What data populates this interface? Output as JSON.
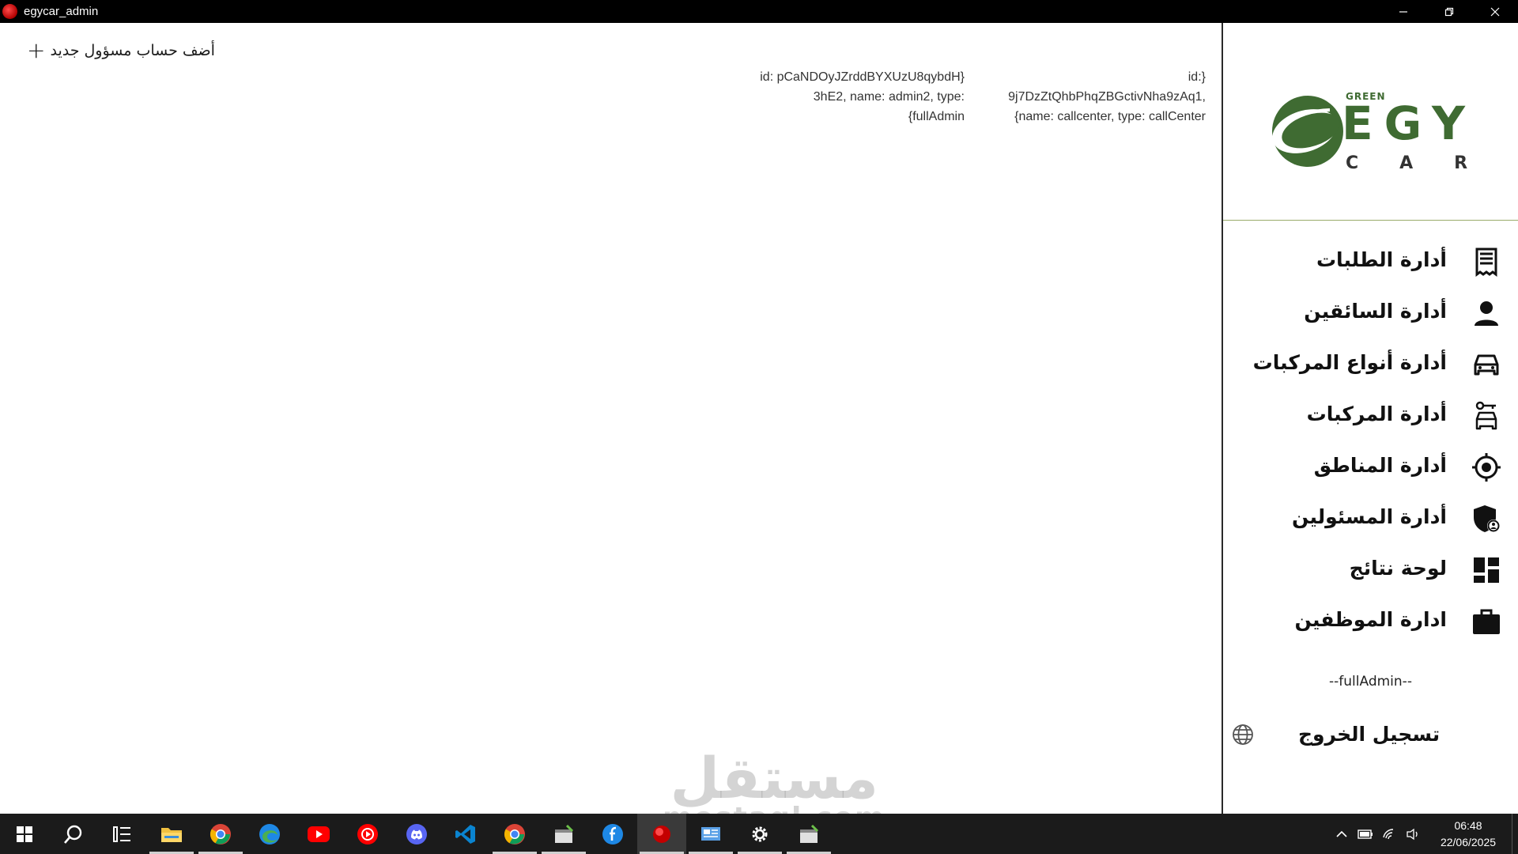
{
  "window": {
    "title": "egycar_admin"
  },
  "main": {
    "add_admin_label": "أضف حساب مسؤول جديد",
    "records": [
      {
        "lines": [
          "id:}",
          "9j7DzZtQhbPhqZBGctivNha9zAq1,",
          "{name: callcenter, type: callCenter"
        ]
      },
      {
        "lines": [
          "id: pCaNDOyJZrddBYXUzU8qybdH}",
          "3hE2, name: admin2, type:",
          "{fullAdmin"
        ]
      }
    ]
  },
  "sidebar": {
    "logo": {
      "small": "GREEN",
      "line1": "EGY",
      "line2": "CAR"
    },
    "items": [
      {
        "label": "أدارة الطلبات",
        "icon": "receipt-icon"
      },
      {
        "label": "أدارة السائقين",
        "icon": "person-icon"
      },
      {
        "label": "أدارة أنواع المركبات",
        "icon": "car-icon"
      },
      {
        "label": "أدارة المركبات",
        "icon": "car-key-icon"
      },
      {
        "label": "أدارة المناطق",
        "icon": "location-target-icon"
      },
      {
        "label": "أدارة المسئولين",
        "icon": "admin-shield-icon"
      },
      {
        "label": "لوحة نتائج",
        "icon": "dashboard-icon"
      },
      {
        "label": "ادارة الموظفين",
        "icon": "briefcase-icon"
      }
    ],
    "role_label": "--fullAdmin--",
    "logout_label": "تسجيل الخروج"
  },
  "watermark": {
    "arabic": "مستقل",
    "latin": "mostaql.com"
  },
  "taskbar": {
    "clock_time": "06:48",
    "clock_date": "22/06/2025"
  }
}
